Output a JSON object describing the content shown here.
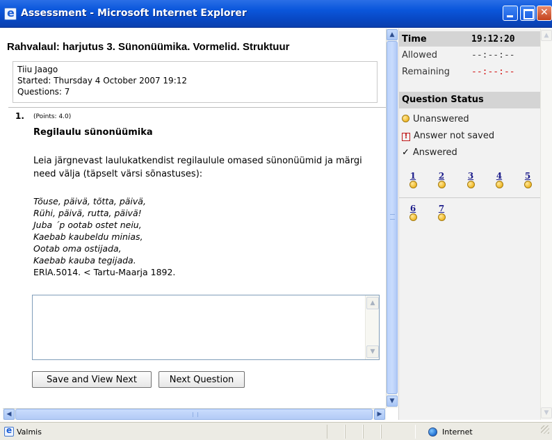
{
  "window": {
    "title": "Assessment - Microsoft Internet Explorer"
  },
  "assessment": {
    "title": "Rahvalaul: harjutus 3. Sünonüümika. Vormelid. Struktuur",
    "student": "Tiiu Jaago",
    "started": "Started: Thursday 4 October 2007 19:12",
    "questions": "Questions: 7"
  },
  "question": {
    "number": "1.",
    "points": "(Points: 4.0)",
    "title": "Regilaulu sünonüümika",
    "text": "Leia järgnevast laulukatkendist regilaulule omased sünonüümid ja märgi need välja (täpselt värsi sõnastuses):",
    "poem": [
      "Tõuse, päivä, tõtta, päivä,",
      "Rühi, päivä, rutta, päivä!",
      "Juba ´p ootab ostet neiu,",
      "Kaebab kaubeldu minias,",
      "Ootab oma ostijada,",
      "Kaebab kauba tegijada."
    ],
    "source": "ERlA.5014. < Tartu-Maarja 1892.",
    "answer_value": ""
  },
  "buttons": {
    "save_next": "Save and View Next",
    "next": "Next Question"
  },
  "timer": {
    "label": "Time",
    "clock": "19:12:20",
    "allowed_label": "Allowed",
    "allowed_value": "--:--:--",
    "remaining_label": "Remaining",
    "remaining_value": "--:--:--"
  },
  "status": {
    "heading": "Question Status",
    "unanswered": "Unanswered",
    "not_saved": "Answer not saved",
    "answered": "Answered",
    "question_links": [
      "1",
      "2",
      "3",
      "4",
      "5",
      "6",
      "7"
    ]
  },
  "statusbar": {
    "text": "Valmis",
    "zone": "Internet"
  },
  "colors": {
    "title_bar": "#0b57dc",
    "remaining_value": "#d21818",
    "unanswered_dot": "#f0b828",
    "link": "#1c1c8a"
  },
  "icons": {
    "unanswered": "circle",
    "not_saved": "exclamation-box",
    "answered": "check-mark"
  }
}
